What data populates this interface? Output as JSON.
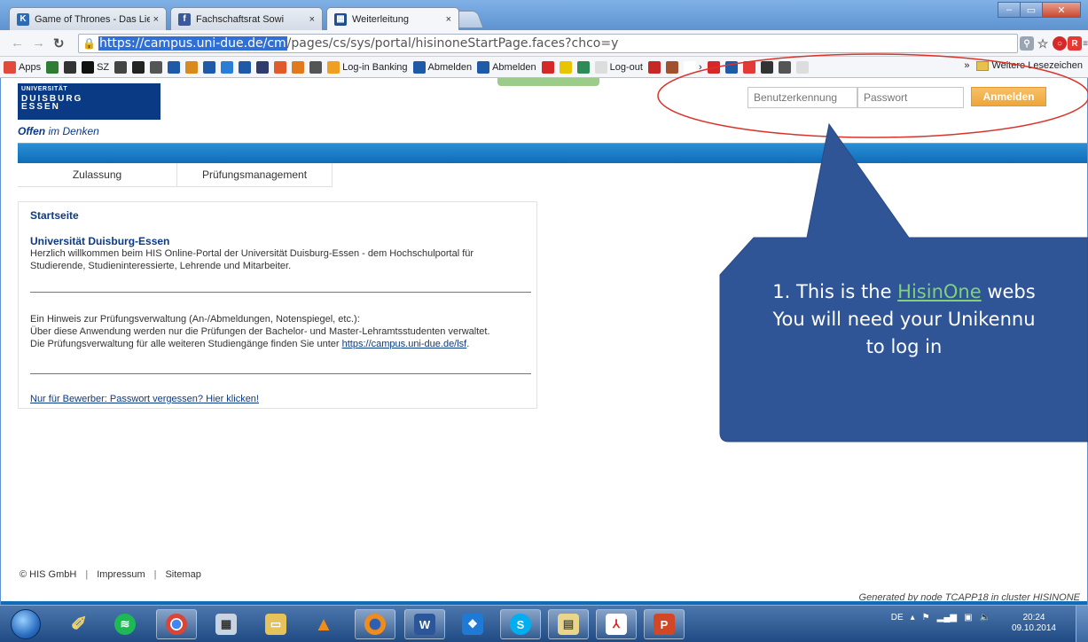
{
  "browser": {
    "tabs": [
      {
        "title": "Game of Thrones - Das Lie",
        "favicon": "K",
        "color": "#2d6ab4"
      },
      {
        "title": "Fachschaftsrat Sowi",
        "favicon": "f",
        "color": "#3b5998"
      },
      {
        "title": "Weiterleitung",
        "favicon": "▦",
        "color": "#1f4f8f"
      }
    ],
    "tab_close": "×",
    "url_selected": "https://campus.uni-due.de/cm",
    "url_rest": "/pages/cs/sys/portal/hisinoneStartPage.faces?chco=y",
    "bookmarks": [
      {
        "label": "Apps",
        "color": "#e24b3c"
      },
      {
        "label": "",
        "color": "#2e7d32"
      },
      {
        "label": "",
        "color": "#333333"
      },
      {
        "label": "SZ",
        "color": "#111111"
      },
      {
        "label": "",
        "color": "#444444"
      },
      {
        "label": "",
        "color": "#222222"
      },
      {
        "label": "",
        "color": "#555555"
      },
      {
        "label": "",
        "color": "#1f5aa8"
      },
      {
        "label": "",
        "color": "#d98a1c"
      },
      {
        "label": "",
        "color": "#1f5aa8"
      },
      {
        "label": "",
        "color": "#2a7fd4"
      },
      {
        "label": "",
        "color": "#1f5aa8"
      },
      {
        "label": "",
        "color": "#2e3d6b"
      },
      {
        "label": "",
        "color": "#e05a2a"
      },
      {
        "label": "",
        "color": "#e07a1c"
      },
      {
        "label": "",
        "color": "#555555"
      },
      {
        "label": "Log-in Banking",
        "color": "#f0a020"
      },
      {
        "label": "Abmelden",
        "color": "#1f5aa8"
      },
      {
        "label": "Abmelden",
        "color": "#1f5aa8"
      },
      {
        "label": "",
        "color": "#d62828"
      },
      {
        "label": "",
        "color": "#e9c400"
      },
      {
        "label": "",
        "color": "#2e8b57"
      },
      {
        "label": "Log-out",
        "color": "#dddddd"
      },
      {
        "label": "",
        "color": "#c62828"
      },
      {
        "label": "",
        "color": "#a0522d"
      },
      {
        "label": "›",
        "color": "#ffffff"
      },
      {
        "label": "",
        "color": "#d62828"
      },
      {
        "label": "",
        "color": "#1f5aa8"
      },
      {
        "label": "",
        "color": "#e53935"
      },
      {
        "label": "",
        "color": "#333333"
      },
      {
        "label": "",
        "color": "#555555"
      },
      {
        "label": "",
        "color": "#dddddd"
      }
    ],
    "more_bookmarks": "»",
    "other_bookmarks": "Weitere Lesezeichen"
  },
  "site": {
    "logo_line1": "UNIVERSITÄT",
    "logo_line2": "DUISBURG",
    "logo_line3": "ESSEN",
    "tagline_bold": "Offen",
    "tagline_rest": " im Denken",
    "login": {
      "username_placeholder": "Benutzerkennung",
      "password_placeholder": "Passwort",
      "button": "Anmelden"
    },
    "menu": [
      "Zulassung",
      "Prüfungsmanagement"
    ]
  },
  "content": {
    "title": "Startseite",
    "heading": "Universität Duisburg-Essen",
    "welcome": "Herzlich willkommen beim HIS Online-Portal der Universität Duisburg-Essen - dem Hochschulportal für Studierende, Studieninteressierte, Lehrende und Mitarbeiter.",
    "hint_line1": "Ein Hinweis zur Prüfungsverwaltung (An-/Abmeldungen, Notenspiegel, etc.):",
    "hint_line2": "Über diese Anwendung werden nur die Prüfungen der Bachelor- und Master-Lehramtsstudenten verwaltet.",
    "hint_line3_prefix": "Die Prüfungsverwaltung für alle weiteren Studiengänge finden Sie unter ",
    "hint_link": "https://campus.uni-due.de/lsf",
    "hint_line3_suffix": ".",
    "applicant_link": "Nur für Bewerber: Passwort vergessen? Hier klicken!"
  },
  "footer": {
    "copyright": "© HIS GmbH",
    "impressum": "Impressum",
    "sitemap": "Sitemap",
    "separator": "|",
    "generated": "Generated by node TCAPP18 in cluster HISINONE"
  },
  "callout": {
    "line1_prefix": "1. This is  the ",
    "line1_link": "HisinOne",
    "line1_suffix": " webs",
    "line2": "You will need your Unikennu",
    "line3": "to log in",
    "fill": "#2f5597",
    "ellipse_color": "#d9342b"
  },
  "taskbar": {
    "language": "DE",
    "time": "20:24",
    "date": "09.10.2014"
  }
}
